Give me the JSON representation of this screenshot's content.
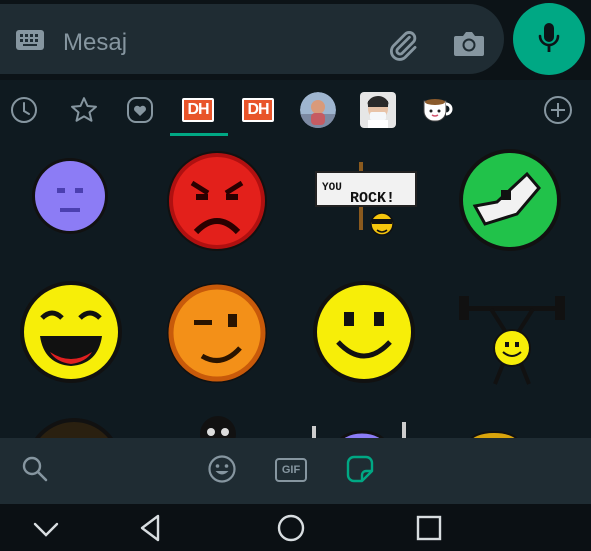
{
  "composer": {
    "placeholder": "Mesaj",
    "keyboard_icon": "keyboard-icon",
    "attach_icon": "paperclip-icon",
    "camera_icon": "camera-icon",
    "mic_icon": "microphone-icon",
    "mic_color": "#00a884"
  },
  "sticker_tabs": {
    "items": [
      {
        "icon": "clock-icon"
      },
      {
        "icon": "star-icon"
      },
      {
        "icon": "heart-icon"
      },
      {
        "label": "DH",
        "selected": true
      },
      {
        "label": "DH"
      },
      {
        "icon": "avatar-pack"
      },
      {
        "icon": "avatar-pack"
      },
      {
        "icon": "coffee-cup-icon"
      },
      {
        "icon": "add-icon"
      }
    ],
    "accent_color": "#00a884"
  },
  "stickers": {
    "rock_sign_top": "YOU",
    "rock_sign_bottom": "ROCK!"
  },
  "bottom_bar": {
    "search_icon": "search-icon",
    "emoji_icon": "emoji-icon",
    "gif_label": "GIF",
    "sticker_icon": "sticker-icon"
  },
  "system_nav": {
    "icons": [
      "collapse-icon",
      "back-icon",
      "home-icon",
      "recents-icon"
    ]
  }
}
